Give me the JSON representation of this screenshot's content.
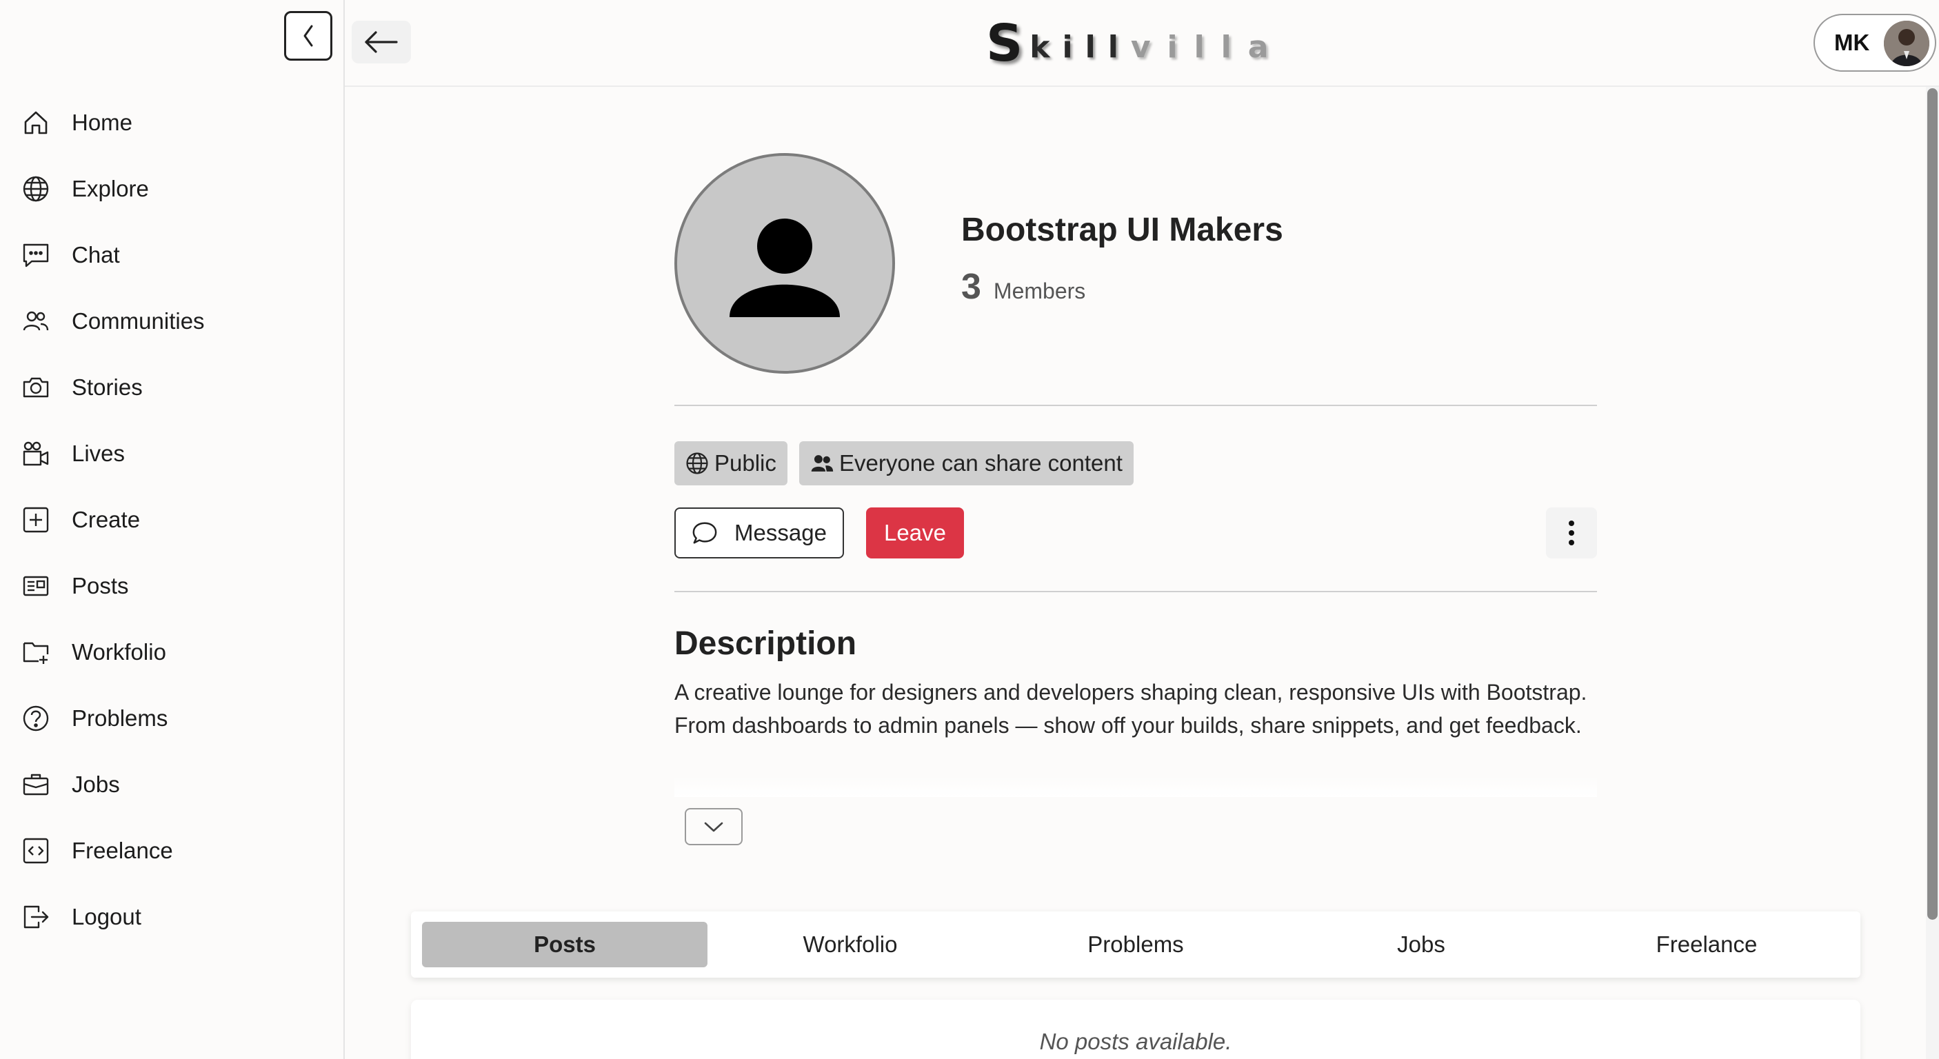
{
  "sidebar": {
    "items": [
      {
        "label": "Home",
        "icon": "home-icon"
      },
      {
        "label": "Explore",
        "icon": "globe-icon"
      },
      {
        "label": "Chat",
        "icon": "chat-icon"
      },
      {
        "label": "Communities",
        "icon": "people-icon"
      },
      {
        "label": "Stories",
        "icon": "camera-icon"
      },
      {
        "label": "Lives",
        "icon": "video-camera-icon"
      },
      {
        "label": "Create",
        "icon": "plus-square-icon"
      },
      {
        "label": "Posts",
        "icon": "newspaper-icon"
      },
      {
        "label": "Workfolio",
        "icon": "folder-plus-icon"
      },
      {
        "label": "Problems",
        "icon": "question-circle-icon"
      },
      {
        "label": "Jobs",
        "icon": "briefcase-icon"
      },
      {
        "label": "Freelance",
        "icon": "code-square-icon"
      },
      {
        "label": "Logout",
        "icon": "logout-icon"
      }
    ]
  },
  "header": {
    "logo_first": "S",
    "logo_dark": "kill",
    "logo_light": "villa",
    "user_initials": "MK"
  },
  "community": {
    "name": "Bootstrap UI Makers",
    "member_count": "3",
    "member_label": "Members",
    "badges": {
      "visibility": "Public",
      "sharing": "Everyone can share content"
    },
    "actions": {
      "message": "Message",
      "leave": "Leave"
    },
    "description_title": "Description",
    "description_text": "A creative lounge for designers and developers shaping clean, responsive UIs with Bootstrap. From dashboards to admin panels — show off your builds, share snippets, and get feedback."
  },
  "tabs": [
    {
      "label": "Posts",
      "active": true
    },
    {
      "label": "Workfolio",
      "active": false
    },
    {
      "label": "Problems",
      "active": false
    },
    {
      "label": "Jobs",
      "active": false
    },
    {
      "label": "Freelance",
      "active": false
    }
  ],
  "posts": {
    "empty_message": "No posts available."
  },
  "colors": {
    "leave_button": "#dc3545",
    "active_tab": "#bdbdbd",
    "badge_bg": "#cfcfcf"
  }
}
